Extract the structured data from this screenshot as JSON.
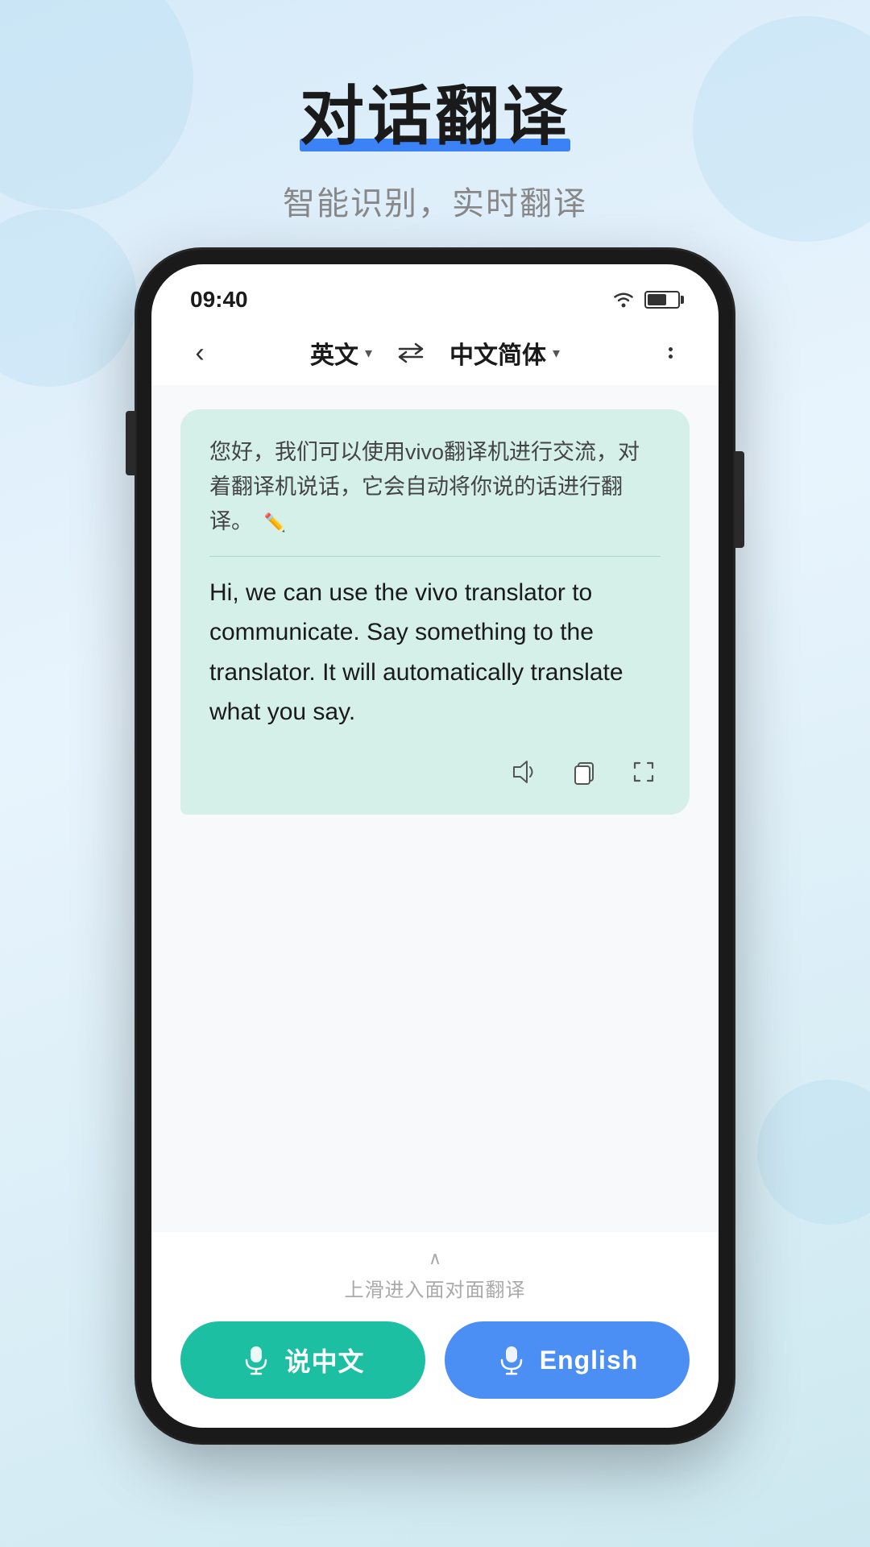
{
  "background": {
    "color_start": "#d6eaf8",
    "color_end": "#cde8f0"
  },
  "top_section": {
    "main_title": "对话翻译",
    "sub_title": "智能识别，实时翻译"
  },
  "status_bar": {
    "time": "09:40"
  },
  "nav": {
    "source_lang": "英文",
    "target_lang": "中文简体"
  },
  "message": {
    "original": "您好，我们可以使用vivo翻译机进行交流，对着翻译机说话，它会自动将你说的话进行翻译。",
    "translated": "Hi, we can use the vivo translator to communicate. Say something to the translator. It will  automatically translate what you say."
  },
  "bottom": {
    "slide_hint": "上滑进入面对面翻译",
    "btn_chinese_label": "说中文",
    "btn_english_label": "English"
  }
}
